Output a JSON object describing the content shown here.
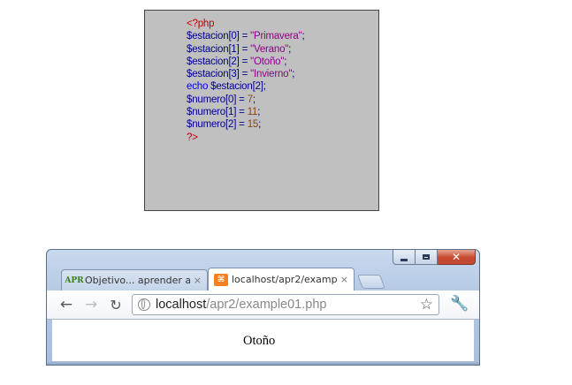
{
  "code": {
    "lines": [
      [
        {
          "t": "<?php",
          "c": "tag"
        }
      ],
      [
        {
          "t": "$estacion",
          "c": "var"
        },
        {
          "t": "[0] = ",
          "c": "op"
        },
        {
          "t": "\"Primavera\"",
          "c": "str"
        },
        {
          "t": ";",
          "c": "op"
        }
      ],
      [
        {
          "t": "$estacion",
          "c": "var"
        },
        {
          "t": "[1] = ",
          "c": "op"
        },
        {
          "t": "\"Verano\"",
          "c": "str"
        },
        {
          "t": ";",
          "c": "op"
        }
      ],
      [
        {
          "t": "$estacion",
          "c": "var"
        },
        {
          "t": "[2] = ",
          "c": "op"
        },
        {
          "t": "\"Otoño\"",
          "c": "str"
        },
        {
          "t": ";",
          "c": "op"
        }
      ],
      [
        {
          "t": "$estacion",
          "c": "var"
        },
        {
          "t": "[3] = ",
          "c": "op"
        },
        {
          "t": "\"Invierno\"",
          "c": "str"
        },
        {
          "t": ";",
          "c": "op"
        }
      ],
      [
        {
          "t": "echo ",
          "c": "kw"
        },
        {
          "t": "$estacion",
          "c": "var"
        },
        {
          "t": "[2];",
          "c": "op"
        }
      ],
      [
        {
          "t": "$numero",
          "c": "var"
        },
        {
          "t": "[0] = ",
          "c": "op"
        },
        {
          "t": "7",
          "c": "num"
        },
        {
          "t": ";",
          "c": "op"
        }
      ],
      [
        {
          "t": "$numero",
          "c": "var"
        },
        {
          "t": "[1] = ",
          "c": "op"
        },
        {
          "t": "11",
          "c": "num"
        },
        {
          "t": ";",
          "c": "op"
        }
      ],
      [
        {
          "t": "$numero",
          "c": "var"
        },
        {
          "t": "[2] = ",
          "c": "op"
        },
        {
          "t": "15",
          "c": "num"
        },
        {
          "t": ";",
          "c": "op"
        }
      ],
      [
        {
          "t": "?>",
          "c": "tag"
        }
      ]
    ],
    "colors": {
      "tag": "#c00000",
      "var": "#00008b",
      "str": "#8b008b",
      "kw": "#0000ee",
      "num": "#8b4513",
      "background": "#c0c0c0"
    }
  },
  "browser": {
    "window_controls": {
      "minimize_icon": "minimize-icon",
      "maximize_icon": "maximize-icon",
      "close_icon": "close-icon",
      "close_glyph": "✕"
    },
    "tabs": [
      {
        "favicon_text": "APR",
        "title": "Objetivo... aprender a",
        "close_glyph": "×",
        "active": false
      },
      {
        "favicon_text": "⌘",
        "title": "localhost/apr2/examp",
        "close_glyph": "×",
        "active": true
      }
    ],
    "toolbar": {
      "back_glyph": "←",
      "forward_glyph": "→",
      "reload_glyph": "↻",
      "url_host": "localhost",
      "url_path": "/apr2/example01.php",
      "star_glyph": "☆",
      "wrench_glyph": "🔧"
    },
    "page": {
      "text": "Otoño"
    }
  }
}
